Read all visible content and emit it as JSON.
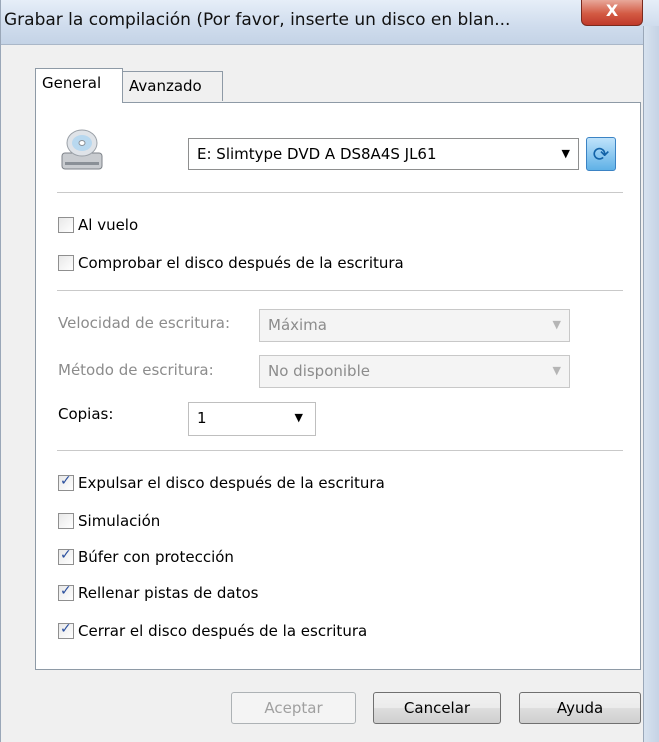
{
  "window": {
    "title": "Grabar la compilación (Por favor, inserte un disco en blan...",
    "close_label": "X"
  },
  "tabs": [
    {
      "label": "General",
      "active": true
    },
    {
      "label": "Avanzado",
      "active": false
    }
  ],
  "drive": {
    "icon": "cd-drive-icon",
    "selected": "E: Slimtype DVD A DS8A4S JL61",
    "refresh_icon": "refresh-icon"
  },
  "options_top": [
    {
      "label": "Al vuelo",
      "checked": false
    },
    {
      "label": "Comprobar el disco después de la escritura",
      "checked": false
    }
  ],
  "write_speed": {
    "label": "Velocidad de escritura:",
    "value": "Máxima",
    "enabled": false
  },
  "write_method": {
    "label": "Método de escritura:",
    "value": "No disponible",
    "enabled": false
  },
  "copies": {
    "label": "Copias:",
    "value": "1"
  },
  "options_bottom": [
    {
      "label": "Expulsar el disco después de la escritura",
      "checked": true
    },
    {
      "label": "Simulación",
      "checked": false
    },
    {
      "label": "Búfer con protección",
      "checked": true
    },
    {
      "label": "Rellenar pistas de datos",
      "checked": true
    },
    {
      "label": "Cerrar el disco después de la escritura",
      "checked": true
    }
  ],
  "buttons": {
    "accept": "Aceptar",
    "cancel": "Cancelar",
    "help": "Ayuda"
  }
}
